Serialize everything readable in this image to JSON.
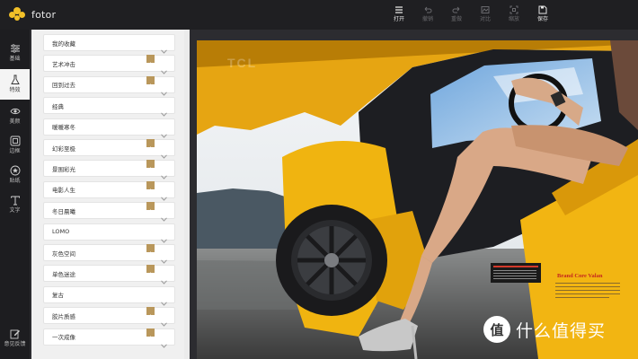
{
  "brand": {
    "name": "fotor",
    "mark_color": "#F2C028"
  },
  "toolbar": {
    "items": [
      {
        "label": "打开",
        "icon": "menu-icon",
        "enabled": true
      },
      {
        "label": "撤销",
        "icon": "undo-icon",
        "enabled": false
      },
      {
        "label": "重做",
        "icon": "redo-icon",
        "enabled": false
      },
      {
        "label": "对比",
        "icon": "compare-icon",
        "enabled": false
      },
      {
        "label": "缩放",
        "icon": "zoom-icon",
        "enabled": false
      },
      {
        "label": "保存",
        "icon": "save-icon",
        "enabled": true
      }
    ]
  },
  "leftnav": {
    "items": [
      {
        "label": "基础",
        "icon": "sliders-icon",
        "active": false
      },
      {
        "label": "特效",
        "icon": "flask-icon",
        "active": true
      },
      {
        "label": "美颜",
        "icon": "eye-icon",
        "active": false
      },
      {
        "label": "边框",
        "icon": "frame-icon",
        "active": false
      },
      {
        "label": "贴纸",
        "icon": "sticker-icon",
        "active": false
      },
      {
        "label": "文字",
        "icon": "text-icon",
        "active": false
      }
    ],
    "feedback_label": "意见反馈"
  },
  "effects_panel": {
    "categories": [
      {
        "label": "我的收藏",
        "premium": false
      },
      {
        "label": "艺术冲击",
        "premium": true
      },
      {
        "label": "回到过去",
        "premium": true
      },
      {
        "label": "经典",
        "premium": false
      },
      {
        "label": "暖暖寒冬",
        "premium": false
      },
      {
        "label": "幻彩至极",
        "premium": true
      },
      {
        "label": "景围彩光",
        "premium": true
      },
      {
        "label": "电影人生",
        "premium": true
      },
      {
        "label": "冬日晨曦",
        "premium": true
      },
      {
        "label": "LOMO",
        "premium": false
      },
      {
        "label": "灰色空间",
        "premium": true
      },
      {
        "label": "单色迷途",
        "premium": true
      },
      {
        "label": "复古",
        "premium": false
      },
      {
        "label": "胶片质感",
        "premium": true
      },
      {
        "label": "一次成像",
        "premium": true
      }
    ]
  },
  "photo": {
    "overlay_text": "TCL",
    "decal_text": "Brand Core Valan"
  },
  "watermark": {
    "icon_glyph": "值",
    "text": "什么值得买"
  },
  "colors": {
    "accent": "#F2C028",
    "premium_badge": "#B9975B",
    "topbar": "#1F1F22",
    "panel": "#F0F0F0"
  }
}
